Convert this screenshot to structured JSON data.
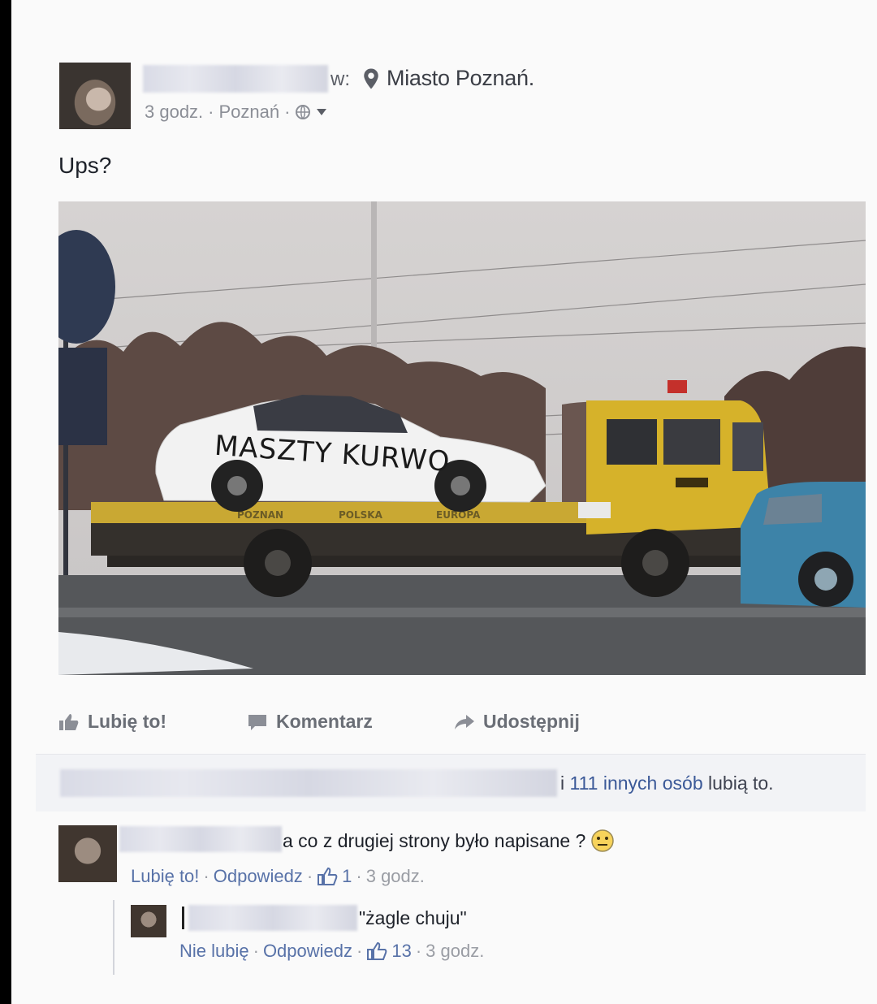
{
  "post": {
    "location_prefix": "w:",
    "location": "Miasto Poznań.",
    "time": "3 godz.",
    "place": "Poznań",
    "sep": "·",
    "text": "Ups?",
    "photo_text": {
      "graffiti": "MASZTY KURWO",
      "bed_words": [
        "POZNAN",
        "POLSKA",
        "EUROPA"
      ]
    }
  },
  "actions": {
    "like": "Lubię to!",
    "comment": "Komentarz",
    "share": "Udostępnij"
  },
  "likes": {
    "prefix": "i",
    "count_text": "111 innych osób",
    "suffix": "lubią to."
  },
  "comments": [
    {
      "text": "a co z drugiej strony było napisane ?",
      "like_label": "Lubię to!",
      "reply_label": "Odpowiedz",
      "likes": "1",
      "time": "3 godz."
    },
    {
      "text": "\"żagle chuju\"",
      "like_label": "Nie lubię",
      "reply_label": "Odpowiedz",
      "likes": "13",
      "time": "3 godz."
    }
  ],
  "colors": {
    "link": "#5872a8",
    "truck": "#d6b22a",
    "car": "#f2f2f2"
  }
}
